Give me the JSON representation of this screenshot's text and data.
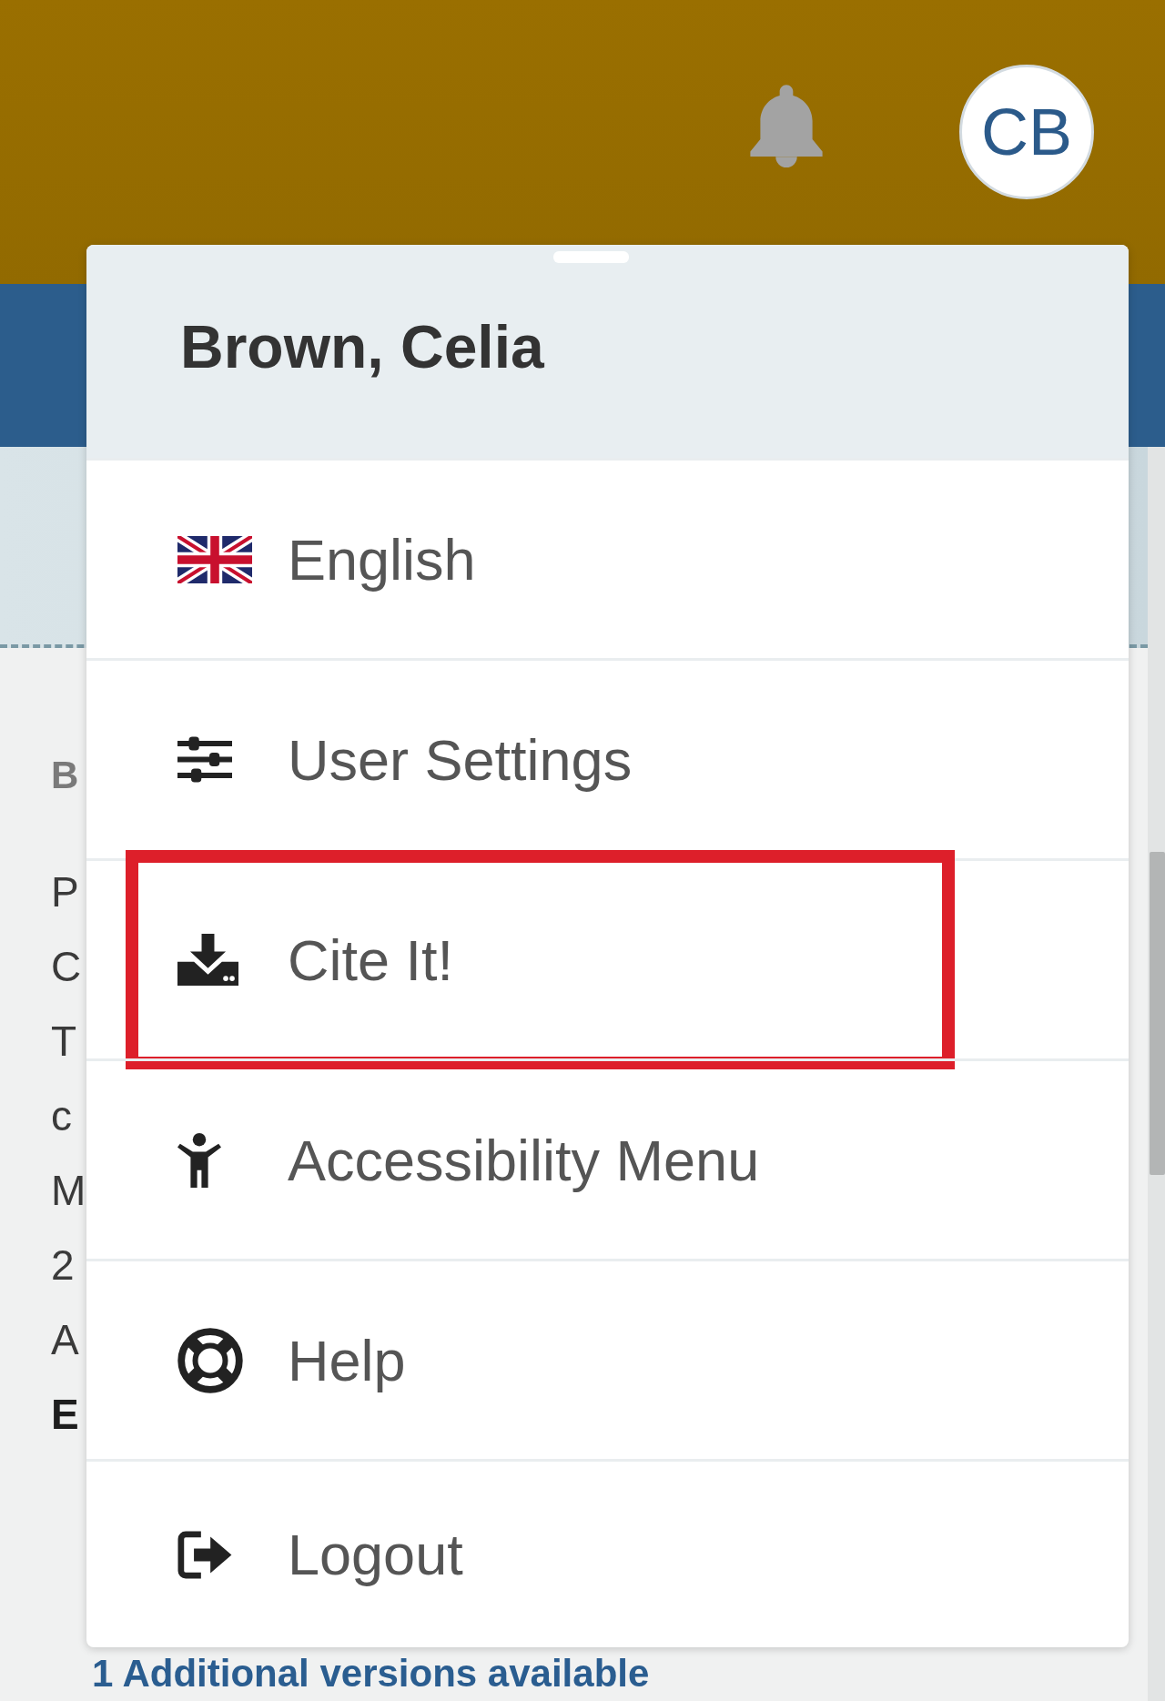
{
  "header": {
    "avatar_initials": "CB"
  },
  "user_menu": {
    "name": "Brown, Celia",
    "items": [
      {
        "kind": "language",
        "label": "English",
        "highlighted": false
      },
      {
        "kind": "settings",
        "label": "User Settings",
        "highlighted": false
      },
      {
        "kind": "cite",
        "label": "Cite It!",
        "highlighted": true
      },
      {
        "kind": "accessibility",
        "label": "Accessibility Menu",
        "highlighted": false
      },
      {
        "kind": "help",
        "label": "Help",
        "highlighted": false
      },
      {
        "kind": "logout",
        "label": "Logout",
        "highlighted": false
      }
    ]
  },
  "background_page": {
    "section_label": "B",
    "lines": [
      {
        "text": "P",
        "bold": false
      },
      {
        "text": "C",
        "bold": false
      },
      {
        "text": "T",
        "bold": false
      },
      {
        "text": "c",
        "bold": false
      },
      {
        "text": "M",
        "bold": false
      },
      {
        "text": "2",
        "bold": false
      },
      {
        "text": "A",
        "bold": false
      },
      {
        "text": "E",
        "bold": true
      }
    ],
    "versions_link": "1 Additional versions available"
  }
}
